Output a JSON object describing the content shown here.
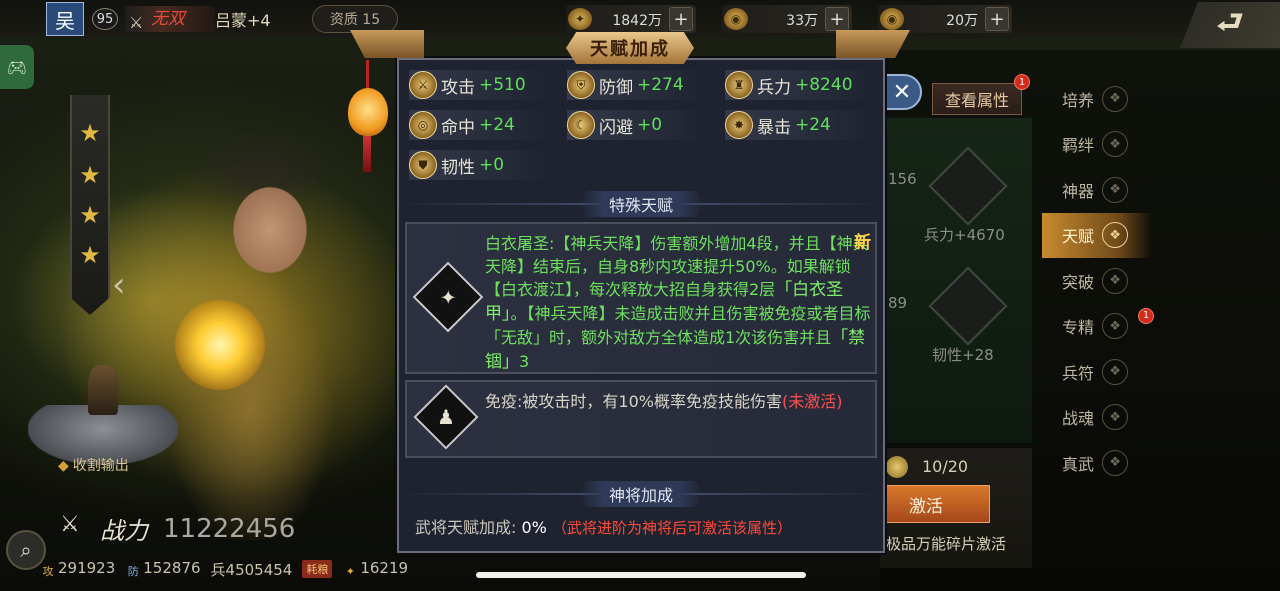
{
  "top_bar": {
    "faction": "吴",
    "level": "95",
    "wushuang": "无双",
    "hero_name": "吕蒙+4",
    "quality": "资质 15",
    "resources": [
      {
        "icon": "wheat-icon",
        "value": "1842万"
      },
      {
        "icon": "silver-ingot-icon",
        "value": "33万"
      },
      {
        "icon": "gold-ingot-icon",
        "value": "20万"
      }
    ],
    "plus": "+",
    "back_glyph": "⮐"
  },
  "left": {
    "harvest": "收割输出",
    "power_label": "战力",
    "power_value": "11222456",
    "stats": {
      "attack": "291923",
      "defense": "152876",
      "troops": "兵4505454",
      "consume_tag": "耗粮",
      "food": "16219"
    }
  },
  "modal": {
    "title": "天赋加成",
    "stats": [
      {
        "name": "攻击",
        "value": "+510"
      },
      {
        "name": "防御",
        "value": "+274"
      },
      {
        "name": "兵力",
        "value": "+8240"
      },
      {
        "name": "命中",
        "value": "+24"
      },
      {
        "name": "闪避",
        "value": "+0"
      },
      {
        "name": "暴击",
        "value": "+24"
      },
      {
        "name": "韧性",
        "value": "+0"
      }
    ],
    "special_header": "特殊天赋",
    "talent1": {
      "new_tag": "新",
      "part1": "白衣屠圣:【神兵天降】伤害额外增加4段，并且【神兵天降】结束后，自身8秒内攻速提升50%。如果解锁【白衣渡江】，每次释放大招自身获得2层",
      "highlight1": "「白衣圣甲」",
      "part2": "。【神兵天降】未造成击败并且伤害被免疫或者目标「无敌」时，额外对敌方全体造成1次该伤害并且",
      "highlight2": "「禁锢」",
      "part3": "3"
    },
    "talent2": {
      "text": "免疫:被攻击时，有10%概率免疫技能伤害",
      "status": "(未激活)"
    },
    "bonus_header": "神将加成",
    "bonus_label": "武将天赋加成: ",
    "bonus_value": "0%",
    "bonus_note": "（武将进阶为神将后可激活该属性）"
  },
  "right": {
    "view_attr": "查看属性",
    "badge": "1",
    "close": "✕",
    "tree_labels": [
      "156",
      "兵力+4670",
      "89",
      "韧性+28"
    ],
    "fragment_progress": "10/20",
    "activate": "激活",
    "fragment_hint": "极品万能碎片激活",
    "menu": [
      {
        "label": "培养",
        "active": false
      },
      {
        "label": "羁绊",
        "active": false
      },
      {
        "label": "神器",
        "active": false
      },
      {
        "label": "天赋",
        "active": true
      },
      {
        "label": "突破",
        "active": false
      },
      {
        "label": "专精",
        "active": false
      },
      {
        "label": "兵符",
        "active": false
      },
      {
        "label": "战魂",
        "active": false
      },
      {
        "label": "真武",
        "active": false
      }
    ]
  }
}
